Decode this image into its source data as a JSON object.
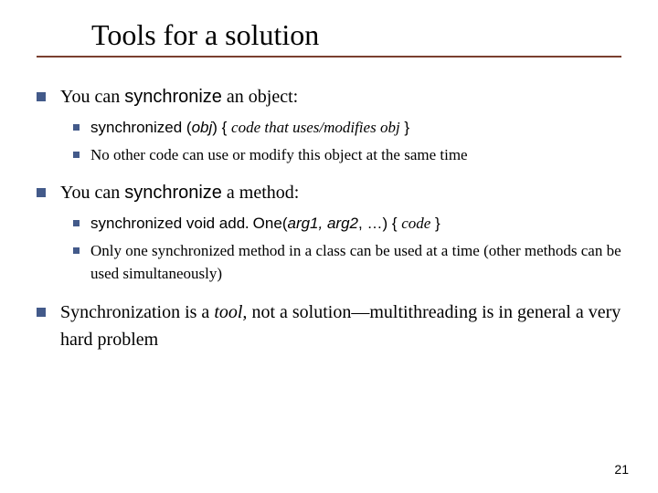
{
  "title": "Tools for a solution",
  "b1": {
    "pre": "You can ",
    "kw": "synchronize",
    "post": " an object:",
    "s1": {
      "kw": "synchronized",
      "paren_open": " (",
      "arg": "obj",
      "paren_close": ") { ",
      "code": "code that uses/modifies obj",
      "close": " }"
    },
    "s2": "No other code can use or modify this object at the same time"
  },
  "b2": {
    "pre": "You can ",
    "kw": "synchronize",
    "post": " a method:",
    "s1": {
      "kw": "synchronized void add",
      "dot": ". ",
      "kw2": "One",
      "paren_open": "(",
      "arg1": "arg1",
      "comma1": ", ",
      "arg2": "arg2",
      "comma2": ", …) { ",
      "code": "code",
      "close": " }"
    },
    "s2": "Only one synchronized method in a class can be used at a time (other methods can be used simultaneously)"
  },
  "b3": {
    "pre": "Synchronization is a ",
    "tool": "tool,",
    "post": " not a solution—multithreading is in general a very hard problem"
  },
  "page_number": "21"
}
